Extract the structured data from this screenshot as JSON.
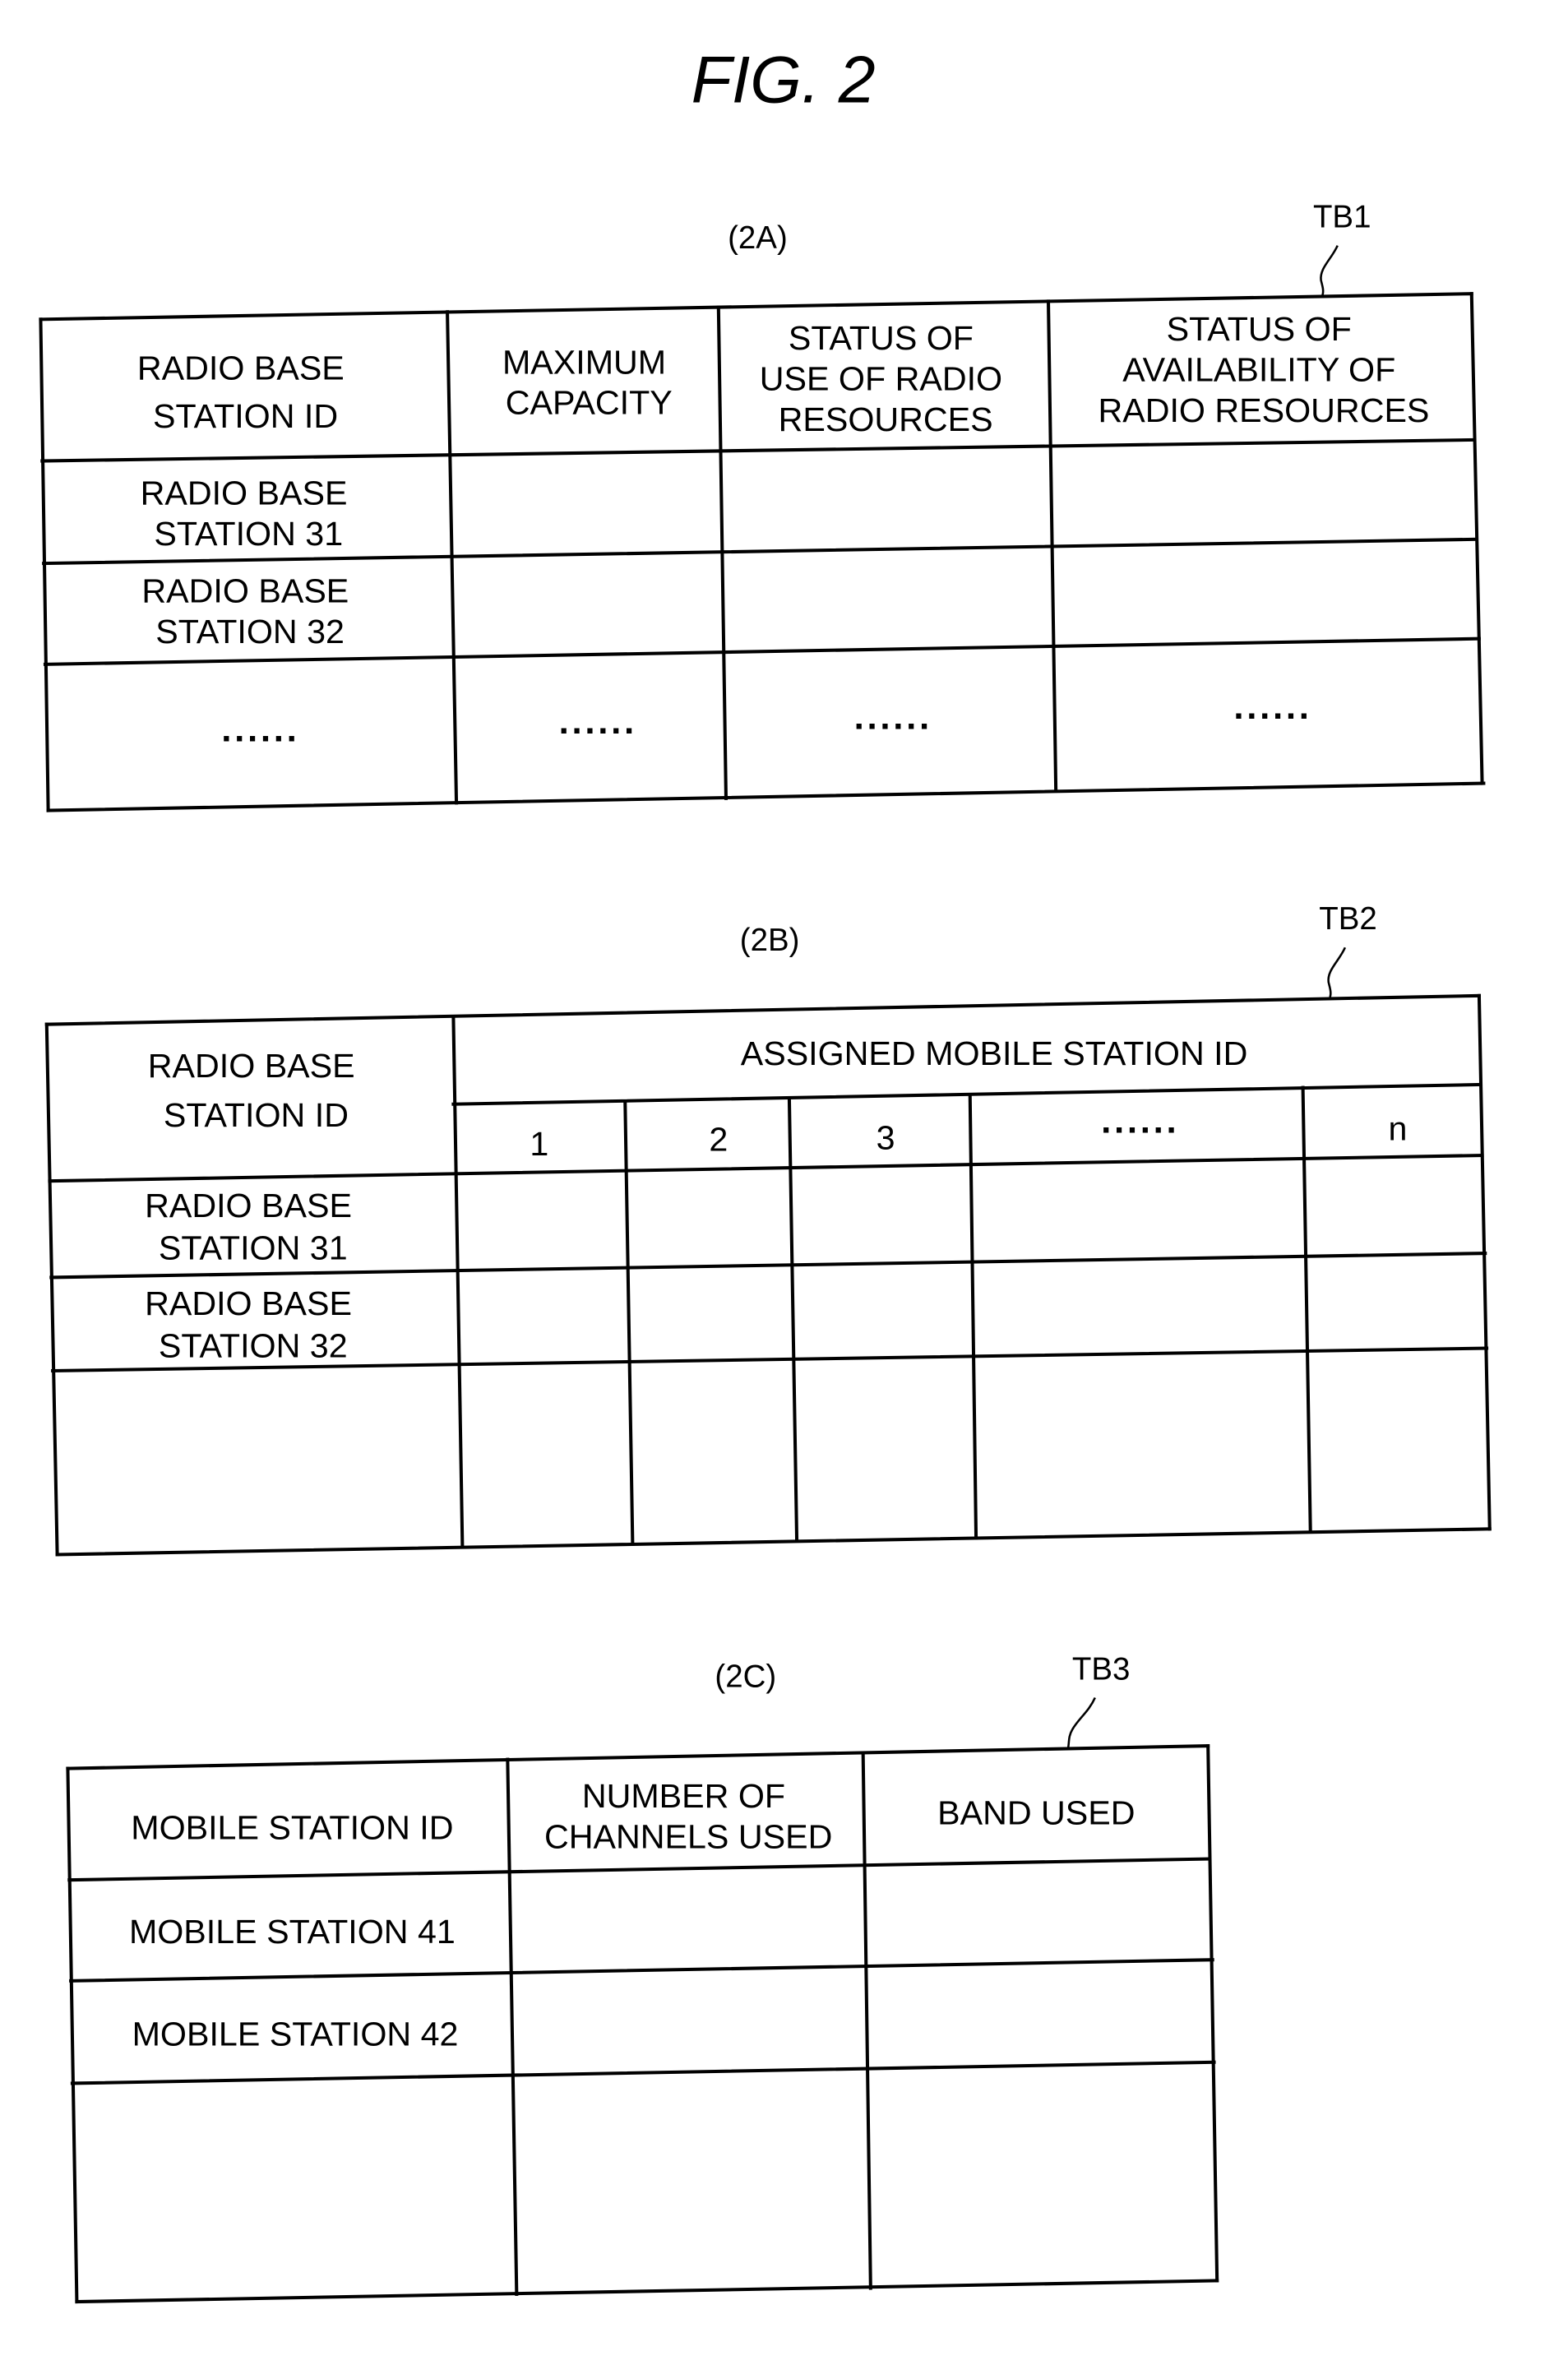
{
  "figure_title": "FIG. 2",
  "tables": {
    "tb1": {
      "panel": "(2A)",
      "ref": "TB1",
      "headers": [
        [
          "RADIO BASE",
          "STATION ID"
        ],
        [
          "MAXIMUM",
          "CAPACITY"
        ],
        [
          "STATUS OF",
          "USE OF RADIO",
          "RESOURCES"
        ],
        [
          "STATUS OF",
          "AVAILABILITY OF",
          "RADIO RESOURCES"
        ]
      ],
      "rows": [
        [
          [
            "RADIO BASE",
            "STATION 31"
          ],
          "",
          "",
          ""
        ],
        [
          [
            "RADIO BASE",
            "STATION 32"
          ],
          "",
          "",
          ""
        ],
        [
          "......",
          "......",
          "......",
          "......"
        ]
      ]
    },
    "tb2": {
      "panel": "(2B)",
      "ref": "TB2",
      "header_left": [
        "RADIO BASE",
        "STATION ID"
      ],
      "header_group": "ASSIGNED MOBILE STATION ID",
      "sub_headers": [
        "1",
        "2",
        "3",
        "......",
        "n"
      ],
      "rows": [
        [
          [
            "RADIO BASE",
            "STATION 31"
          ],
          "",
          "",
          "",
          "",
          ""
        ],
        [
          [
            "RADIO BASE",
            "STATION 32"
          ],
          "",
          "",
          "",
          "",
          ""
        ],
        [
          "",
          "",
          "",
          "",
          "",
          ""
        ]
      ]
    },
    "tb3": {
      "panel": "(2C)",
      "ref": "TB3",
      "headers": [
        [
          "MOBILE STATION ID"
        ],
        [
          "NUMBER OF",
          "CHANNELS USED"
        ],
        [
          "BAND USED"
        ]
      ],
      "rows": [
        [
          "MOBILE STATION 41",
          "",
          ""
        ],
        [
          "MOBILE STATION 42",
          "",
          ""
        ],
        [
          "",
          "",
          ""
        ]
      ]
    }
  }
}
